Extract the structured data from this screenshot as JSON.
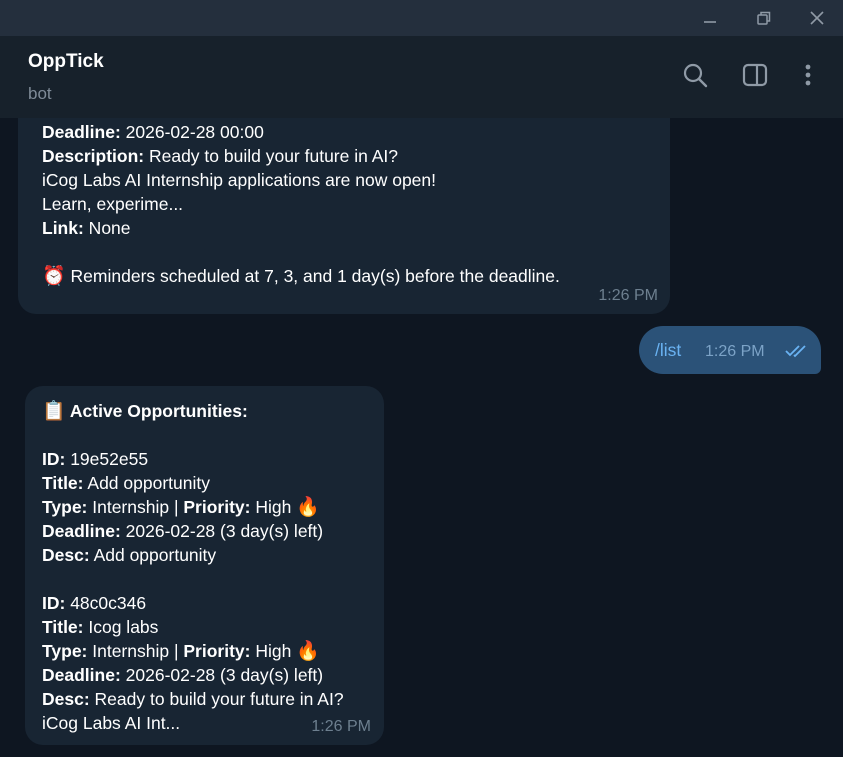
{
  "window": {
    "minimize_label": "—",
    "restore_label": "❐",
    "close_label": "✕"
  },
  "header": {
    "title": "OppTick",
    "status": "bot"
  },
  "messages": {
    "first": {
      "deadline_label": "Deadline:",
      "deadline_value": " 2026-02-28 00:00",
      "description_label": "Description:",
      "description_value": " Ready to build your future in AI?",
      "desc_line2": "iCog Labs AI Internship applications are now open!",
      "desc_line3": "Learn, experime...",
      "link_label": "Link:",
      "link_value": " None",
      "reminder_emoji": "⏰",
      "reminder_text": " Reminders scheduled at 7, 3, and 1 day(s) before the deadline.",
      "time": "1:26 PM"
    },
    "outgoing": {
      "text": "/list",
      "time": "1:26 PM"
    },
    "list": {
      "header_emoji": "📋",
      "header_text": " Active Opportunities:",
      "items": [
        {
          "id_label": "ID:",
          "id_value": " 19e52e55",
          "title_label": "Title:",
          "title_value": " Add opportunity",
          "type_label": "Type:",
          "type_value": " Internship | ",
          "priority_label": "Priority:",
          "priority_value": " High ",
          "priority_emoji": "🔥",
          "deadline_label": "Deadline:",
          "deadline_value": " 2026-02-28 (3 day(s) left)",
          "desc_label": "Desc:",
          "desc_value": " Add opportunity"
        },
        {
          "id_label": "ID:",
          "id_value": " 48c0c346",
          "title_label": "Title:",
          "title_value": " Icog labs",
          "type_label": "Type:",
          "type_value": " Internship | ",
          "priority_label": "Priority:",
          "priority_value": " High ",
          "priority_emoji": "🔥",
          "deadline_label": "Deadline:",
          "deadline_value": " 2026-02-28 (3 day(s) left)",
          "desc_label": "Desc:",
          "desc_value": " Ready to build your future in AI?",
          "desc_line2": "iCog Labs AI Int..."
        }
      ],
      "time": "1:26 PM"
    }
  },
  "colors": {
    "background": "#0e1621",
    "header": "#17212b",
    "titlebar": "#242f3d",
    "incoming_bubble": "#182533",
    "outgoing_bubble": "#2b5278",
    "accent": "#6ab3f3"
  }
}
